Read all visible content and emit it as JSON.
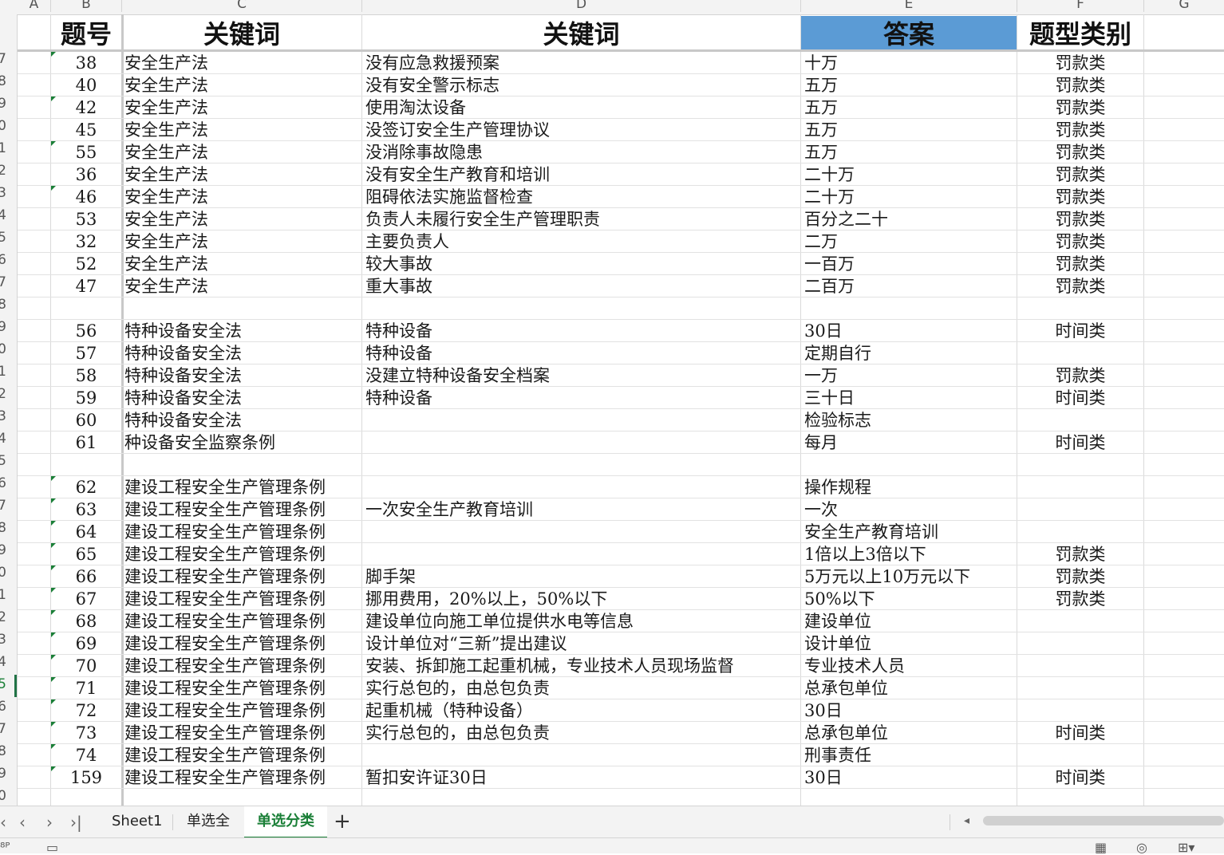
{
  "column_letters": [
    "A",
    "B",
    "C",
    "D",
    "E",
    "F",
    "G"
  ],
  "headers": {
    "b": "题号",
    "c": "关键词",
    "d": "关键词",
    "e": "答案",
    "f": "题型类别"
  },
  "row_labels": [
    "7",
    "8",
    "9",
    "0",
    "1",
    "2",
    "3",
    "4",
    "5",
    "6",
    "7",
    "8",
    "9",
    "0",
    "1",
    "2",
    "3",
    "4",
    "5",
    "6",
    "7",
    "8",
    "9",
    "0",
    "1",
    "2",
    "3",
    "4",
    "5",
    "6",
    "7",
    "8",
    "9",
    "0"
  ],
  "active_row_label": "5",
  "rows": [
    {
      "num": "38",
      "law": "安全生产法",
      "kw": "没有应急救援预案",
      "ans": "十万",
      "cat": "罚款类"
    },
    {
      "num": "40",
      "law": "安全生产法",
      "kw": "没有安全警示标志",
      "ans": "五万",
      "cat": "罚款类"
    },
    {
      "num": "42",
      "law": "安全生产法",
      "kw": "使用淘汰设备",
      "ans": "五万",
      "cat": "罚款类"
    },
    {
      "num": "45",
      "law": "安全生产法",
      "kw": "没签订安全生产管理协议",
      "ans": "五万",
      "cat": "罚款类"
    },
    {
      "num": "55",
      "law": "安全生产法",
      "kw": "没消除事故隐患",
      "ans": "五万",
      "cat": "罚款类"
    },
    {
      "num": "36",
      "law": "安全生产法",
      "kw": "没有安全生产教育和培训",
      "ans": "二十万",
      "cat": "罚款类"
    },
    {
      "num": "46",
      "law": "安全生产法",
      "kw": "阻碍依法实施监督检查",
      "ans": "二十万",
      "cat": "罚款类"
    },
    {
      "num": "53",
      "law": "安全生产法",
      "kw": "负责人未履行安全生产管理职责",
      "ans": "百分之二十",
      "cat": "罚款类"
    },
    {
      "num": "32",
      "law": "安全生产法",
      "kw": "主要负责人",
      "ans": "二万",
      "cat": "罚款类"
    },
    {
      "num": "52",
      "law": "安全生产法",
      "kw": "较大事故",
      "ans": "一百万",
      "cat": "罚款类"
    },
    {
      "num": "47",
      "law": "安全生产法",
      "kw": "重大事故",
      "ans": "二百万",
      "cat": "罚款类"
    },
    {
      "num": "",
      "law": "",
      "kw": "",
      "ans": "",
      "cat": ""
    },
    {
      "num": "56",
      "law": "特种设备安全法",
      "kw": "特种设备",
      "ans": "30日",
      "cat": "时间类"
    },
    {
      "num": "57",
      "law": "特种设备安全法",
      "kw": "特种设备",
      "ans": "定期自行",
      "cat": ""
    },
    {
      "num": "58",
      "law": "特种设备安全法",
      "kw": "没建立特种设备安全档案",
      "ans": "一万",
      "cat": "罚款类"
    },
    {
      "num": "59",
      "law": "特种设备安全法",
      "kw": "特种设备",
      "ans": "三十日",
      "cat": "时间类"
    },
    {
      "num": "60",
      "law": "特种设备安全法",
      "kw": "",
      "ans": "检验标志",
      "cat": ""
    },
    {
      "num": "61",
      "law": "种设备安全监察条例",
      "kw": "",
      "ans": "每月",
      "cat": "时间类"
    },
    {
      "num": "",
      "law": "",
      "kw": "",
      "ans": "",
      "cat": ""
    },
    {
      "num": "62",
      "law": "建设工程安全生产管理条例",
      "kw": "",
      "ans": "操作规程",
      "cat": ""
    },
    {
      "num": "63",
      "law": "建设工程安全生产管理条例",
      "kw": "一次安全生产教育培训",
      "ans": "一次",
      "cat": ""
    },
    {
      "num": "64",
      "law": "建设工程安全生产管理条例",
      "kw": "",
      "ans": "安全生产教育培训",
      "cat": ""
    },
    {
      "num": "65",
      "law": "建设工程安全生产管理条例",
      "kw": "",
      "ans": "1倍以上3倍以下",
      "cat": "罚款类"
    },
    {
      "num": "66",
      "law": "建设工程安全生产管理条例",
      "kw": "脚手架",
      "ans": "5万元以上10万元以下",
      "cat": "罚款类"
    },
    {
      "num": "67",
      "law": "建设工程安全生产管理条例",
      "kw": "挪用费用，20%以上，50%以下",
      "ans": "50%以下",
      "cat": "罚款类"
    },
    {
      "num": "68",
      "law": "建设工程安全生产管理条例",
      "kw": "建设单位向施工单位提供水电等信息",
      "ans": "建设单位",
      "cat": ""
    },
    {
      "num": "69",
      "law": "建设工程安全生产管理条例",
      "kw": "设计单位对“三新”提出建议",
      "ans": "设计单位",
      "cat": ""
    },
    {
      "num": "70",
      "law": "建设工程安全生产管理条例",
      "kw": "安装、拆卸施工起重机械，专业技术人员现场监督",
      "ans": "专业技术人员",
      "cat": ""
    },
    {
      "num": "71",
      "law": "建设工程安全生产管理条例",
      "kw": "实行总包的，由总包负责",
      "ans": "总承包单位",
      "cat": ""
    },
    {
      "num": "72",
      "law": "建设工程安全生产管理条例",
      "kw": "起重机械（特种设备）",
      "ans": "30日",
      "cat": ""
    },
    {
      "num": "73",
      "law": "建设工程安全生产管理条例",
      "kw": "实行总包的，由总包负责",
      "ans": "总承包单位",
      "cat": "时间类"
    },
    {
      "num": "74",
      "law": "建设工程安全生产管理条例",
      "kw": "",
      "ans": "刑事责任",
      "cat": ""
    },
    {
      "num": "159",
      "law": "建设工程安全生产管理条例",
      "kw": "暂扣安许证30日",
      "ans": "30日",
      "cat": "时间类"
    },
    {
      "num": "",
      "law": "",
      "kw": "",
      "ans": "",
      "cat": ""
    }
  ],
  "comment_marker_rows": [
    0,
    2,
    4,
    6,
    19,
    20,
    21,
    22,
    23,
    24,
    25,
    26,
    27,
    28,
    29,
    30,
    31,
    32
  ],
  "tabs": {
    "sheet1": "Sheet1",
    "single_all": "单选全",
    "single_category": "单选分类",
    "add": "+"
  },
  "active_tab": "单选分类",
  "colors": {
    "accent_green": "#1a7f37",
    "header_highlight": "#5b9bd5"
  }
}
